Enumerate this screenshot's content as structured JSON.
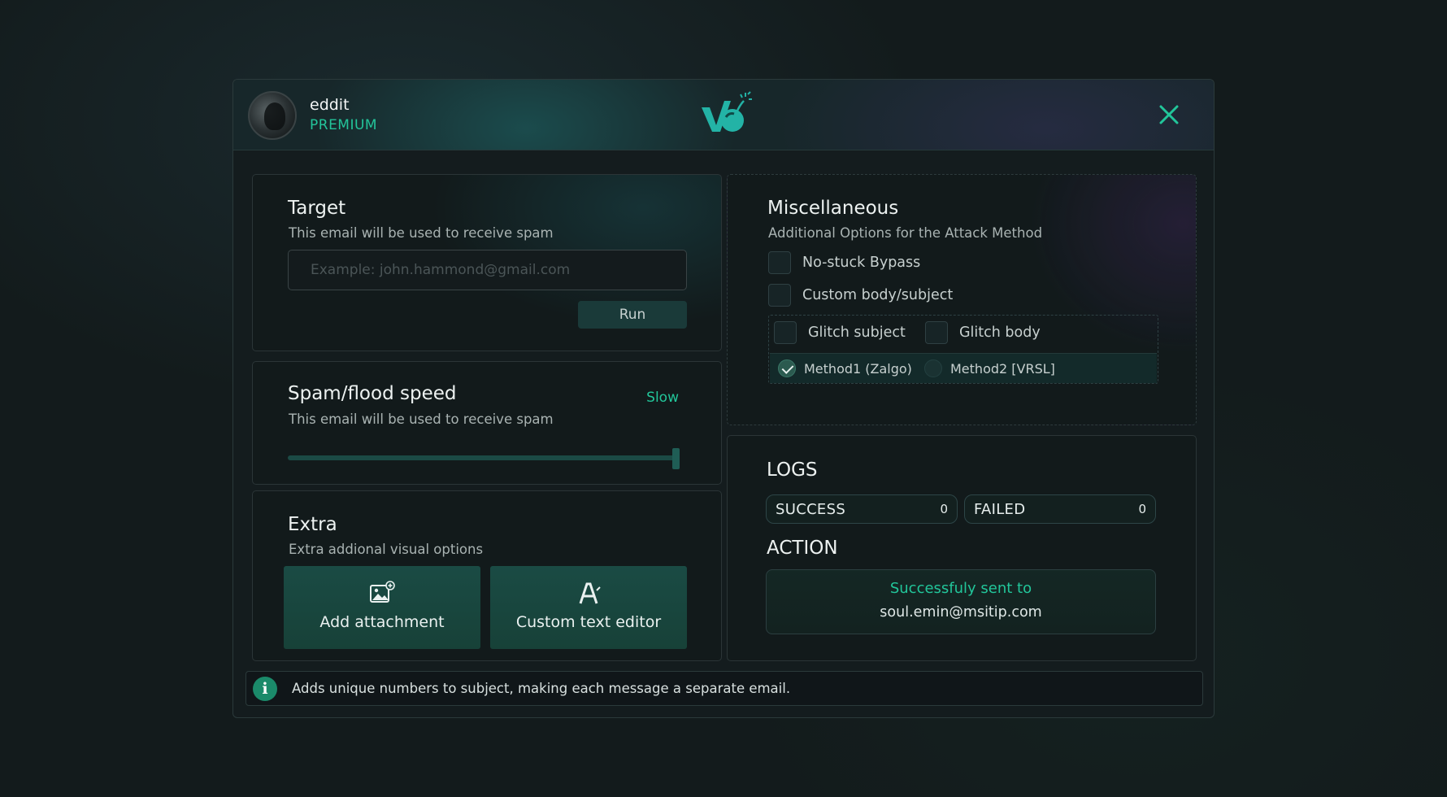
{
  "user": {
    "name": "eddit",
    "tier": "PREMIUM"
  },
  "icons": {
    "logo": "bomb-logo-icon",
    "close": "close-icon",
    "attachment": "image-add-icon",
    "text_editor": "text-edit-icon",
    "info": "info-icon"
  },
  "colors": {
    "accent": "#22c69a",
    "tile": "#1a4b44",
    "background": "#131b1c"
  },
  "target": {
    "title": "Target",
    "subtitle": "This email will be used to receive spam",
    "email_value": "",
    "email_placeholder": "Example: john.hammond@gmail.com",
    "run_label": "Run"
  },
  "speed": {
    "title": "Spam/flood speed",
    "subtitle": "This email will be used to receive spam",
    "value_label": "Slow",
    "slider_fraction": 1.0
  },
  "extra": {
    "title": "Extra",
    "subtitle": "Extra addional visual options",
    "buttons": [
      {
        "label": "Add attachment"
      },
      {
        "label": "Custom text editor"
      }
    ]
  },
  "misc": {
    "title": "Miscellaneous",
    "subtitle": "Additional Options for the Attack Method",
    "options": [
      {
        "label": "No-stuck Bypass",
        "checked": false
      },
      {
        "label": "Custom body/subject",
        "checked": false
      }
    ],
    "glitch": [
      {
        "label": "Glitch subject",
        "checked": false
      },
      {
        "label": "Glitch body",
        "checked": false
      }
    ],
    "methods": [
      {
        "label": "Method1 (Zalgo)",
        "selected": true
      },
      {
        "label": "Method2 [VRSL]",
        "selected": false
      }
    ]
  },
  "logs": {
    "title": "LOGS",
    "success_label": "SUCCESS",
    "success_count": "0",
    "failed_label": "FAILED",
    "failed_count": "0",
    "action_title": "ACTION",
    "action_status": "Successfuly sent to",
    "action_target": "soul.emin@msitip.com"
  },
  "info": {
    "text": "Adds unique numbers to subject, making each message a separate email."
  }
}
